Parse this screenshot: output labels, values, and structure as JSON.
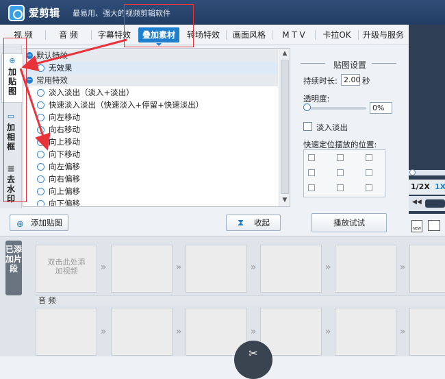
{
  "window": {
    "app_name": "爱剪辑",
    "tagline": "最易用、强大的视频剪辑软件"
  },
  "tabs": [
    {
      "label": "视  频"
    },
    {
      "label": "音  频"
    },
    {
      "label": "字幕特效"
    },
    {
      "label": "叠加素材",
      "active": true
    },
    {
      "label": "转场特效"
    },
    {
      "label": "画面风格"
    },
    {
      "label": "M T V"
    },
    {
      "label": "卡拉OK"
    },
    {
      "label": "升级与服务"
    }
  ],
  "sidebar": {
    "items": [
      {
        "label": "加贴图",
        "icon": "add-sticker-icon",
        "active": true
      },
      {
        "label": "加相框",
        "icon": "frame-icon"
      },
      {
        "label": "去水印",
        "icon": "watermark-icon"
      }
    ]
  },
  "effects": {
    "default_group": "默认特效",
    "default_items": [
      "无效果"
    ],
    "common_group": "常用特效",
    "common_items": [
      "淡入淡出（淡入+淡出）",
      "快速淡入淡出（快速淡入+停留+快速淡出）",
      "向左移动",
      "向右移动",
      "向上移动",
      "向下移动",
      "向左偏移",
      "向右偏移",
      "向上偏移",
      "向下偏移"
    ]
  },
  "settings": {
    "title": "贴图设置",
    "duration_label": "持续时长:",
    "duration_value": "2.00",
    "duration_unit": "秒",
    "opacity_label": "透明度:",
    "opacity_value": "0%",
    "opacity_level": 0,
    "fade_label": "淡入淡出",
    "position_label": "快速定位摆放的位置:"
  },
  "buttons": {
    "add_sticker": "添加贴图",
    "collapse": "收起",
    "preview": "播放试试"
  },
  "right_panel": {
    "speed_half": "1/2X",
    "speed_one": "1X"
  },
  "timeline": {
    "segment_label": "已添加片段",
    "placeholder": "双击此处添加视频",
    "audio_label": "音  频"
  },
  "colors": {
    "title_bar": "#223d63",
    "accent": "#1e7fcf",
    "annotation": "#e8333a"
  }
}
